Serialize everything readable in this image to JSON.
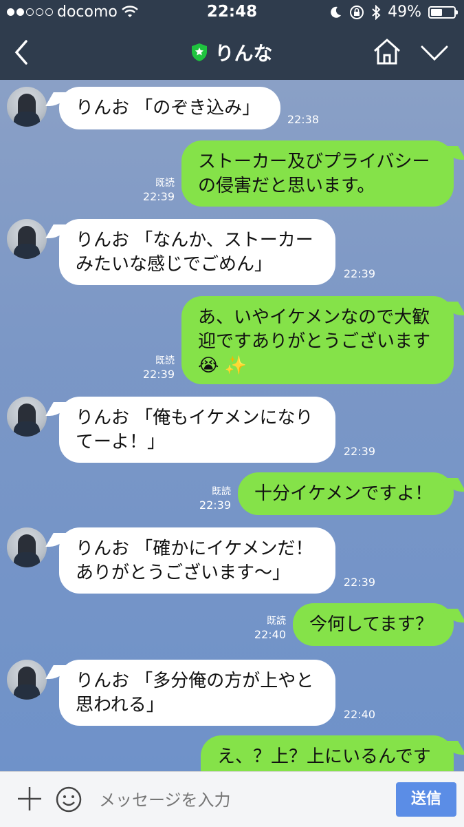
{
  "status_bar": {
    "carrier": "docomo",
    "time": "22:48",
    "battery_percent": "49%",
    "battery_level": 0.49,
    "signal_dots_filled": 2,
    "signal_dots_total": 5
  },
  "nav": {
    "title": "りんな",
    "back_icon": "chevron-left-icon",
    "home_icon": "home-icon",
    "menu_icon": "chevron-down-icon"
  },
  "messages": [
    {
      "side": "in",
      "text": "りんお 「のぞき込み」",
      "time": "22:38"
    },
    {
      "side": "out",
      "text": "ストーカー及びプライバシー\nの侵害だと思います。",
      "read": "既読",
      "time": "22:39"
    },
    {
      "side": "in",
      "text": "りんお 「なんか、ストーカー\nみたいな感じでごめん」",
      "time": "22:39"
    },
    {
      "side": "out",
      "text": "あ、いやイケメンなので大歓\n迎ですありがとうございます\n😭 ✨",
      "read": "既読",
      "time": "22:39"
    },
    {
      "side": "in",
      "text": "りんお 「俺もイケメンになり\nてーよ！」",
      "time": "22:39"
    },
    {
      "side": "out",
      "text": "十分イケメンですよ！",
      "read": "既読",
      "time": "22:39"
    },
    {
      "side": "in",
      "text": "りんお 「確かにイケメンだ！\nありがとうございます〜」",
      "time": "22:39"
    },
    {
      "side": "out",
      "text": "今何してます？",
      "read": "既読",
      "time": "22:40"
    },
    {
      "side": "in",
      "text": "りんお 「多分俺の方が上やと\n思われる」",
      "time": "22:40"
    },
    {
      "side": "out",
      "text": "え、？上？上にいるんです",
      "read": "",
      "time": ""
    }
  ],
  "input_bar": {
    "placeholder": "メッセージを入力",
    "send_label": "送信"
  },
  "colors": {
    "header": "#2f3c4d",
    "outgoing_bubble": "#85e249",
    "incoming_bubble": "#ffffff",
    "send_button": "#5b8de6",
    "verified_shield": "#1fc33f"
  }
}
